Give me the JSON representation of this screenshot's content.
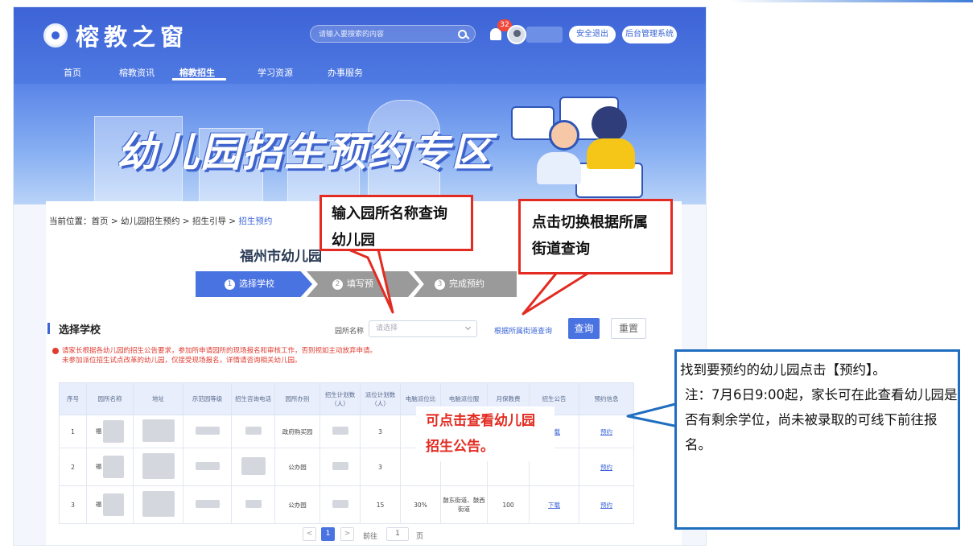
{
  "site": {
    "title": "榕教之窗",
    "search_placeholder": "请输入要搜索的内容",
    "notification_count": "32",
    "logout_label": "安全退出",
    "admin_label": "后台管理系统",
    "nav": [
      "首页",
      "榕教资讯",
      "榕教招生",
      "学习资源",
      "办事服务"
    ],
    "active_nav": "榕教招生"
  },
  "banner": {
    "title": "幼儿园招生预约专区"
  },
  "breadcrumb": {
    "prefix": "当前位置：首页 > 幼儿园招生预约 > 招生引导 > ",
    "current": "招生预约"
  },
  "page": {
    "title": "福州市幼儿园",
    "steps": [
      {
        "num": "1",
        "label": "选择学校"
      },
      {
        "num": "2",
        "label": "填写预"
      },
      {
        "num": "3",
        "label": "完成预约"
      }
    ],
    "section_title": "选择学校",
    "filter_label": "园所名称",
    "select_placeholder": "请选择",
    "street_link": "根据所属街道查询",
    "query_label": "查询",
    "reset_label": "重置",
    "notice_line1": "请家长根据各幼儿园的招生公告要求，参加所申请园所的现场报名和审核工作，否则视如主动放弃申请。",
    "notice_line2": "未参加派位招生试点改革的幼儿园，仅接受现场报名，详情请咨询相关幼儿园。"
  },
  "table": {
    "headers": [
      "序号",
      "园所名称",
      "地址",
      "示范园等级",
      "招生咨询电话",
      "园所办别",
      "招生计划数（人）",
      "派位计划数（人）",
      "电脑派位比",
      "电脑派位服",
      "月保教费",
      "招生公告",
      "预约信息"
    ],
    "rows": [
      {
        "no": "1",
        "name": "福",
        "type": "政府购买园",
        "plan": "3",
        "ratio": "",
        "area": "",
        "fee": "",
        "notice": "下载",
        "reserve": "预约"
      },
      {
        "no": "2",
        "name": "福",
        "type": "公办园",
        "plan": "3",
        "ratio": "",
        "area": "",
        "fee": "",
        "notice": "",
        "reserve": "预约"
      },
      {
        "no": "3",
        "name": "福",
        "type": "公办园",
        "plan": "15",
        "ratio": "30%",
        "area": "鼓东街道、鼓西街道",
        "fee": "100",
        "notice": "下载",
        "reserve": "预约"
      }
    ]
  },
  "pager": {
    "prev": "<",
    "current": "1",
    "next": ">",
    "goto": "前往",
    "page_input": "1",
    "page_unit": "页"
  },
  "annotations": {
    "callout_search": "输入园所名称查询幼儿园",
    "callout_street": "点击切换根据所属街道查询",
    "callout_notice": "可点击查看幼儿园招生公告。",
    "callout_reserve_1": "找到要预约的幼儿园点击【预约】。",
    "callout_reserve_2": "注：7月6日9:00起，家长可在此查看幼儿园是否有剩余学位，尚未被录取的可线下前往报名。"
  },
  "colors": {
    "brand_blue": "#3b64d8",
    "annotation_red": "#e32b21",
    "annotation_blue": "#1f6ec0"
  }
}
